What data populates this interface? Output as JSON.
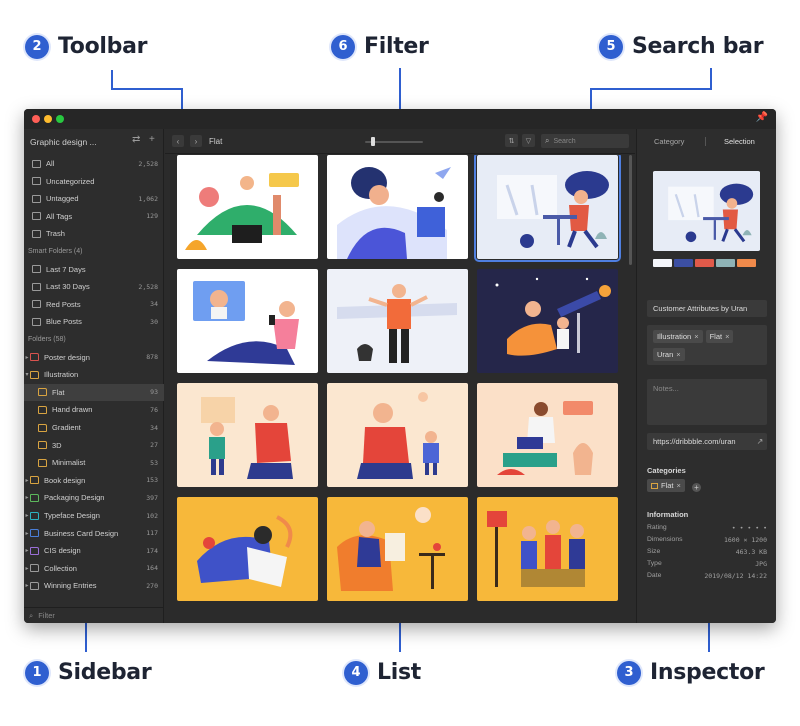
{
  "callouts": {
    "toolbar": {
      "num": "2",
      "label": "Toolbar"
    },
    "filter": {
      "num": "6",
      "label": "Filter"
    },
    "search": {
      "num": "5",
      "label": "Search bar"
    },
    "sidebar": {
      "num": "1",
      "label": "Sidebar"
    },
    "list": {
      "num": "4",
      "label": "List"
    },
    "inspector": {
      "num": "3",
      "label": "Inspector"
    }
  },
  "window": {
    "traffic_lights": [
      "#ff5f57",
      "#febc2e",
      "#28c840"
    ]
  },
  "sidebar": {
    "library_title": "Graphic design ...",
    "library_items": [
      {
        "label": "All",
        "count": "2,528"
      },
      {
        "label": "Uncategorized",
        "count": ""
      },
      {
        "label": "Untagged",
        "count": "1,062"
      },
      {
        "label": "All Tags",
        "count": "129"
      },
      {
        "label": "Trash",
        "count": ""
      }
    ],
    "smart_folders_header": "Smart Folders (4)",
    "smart_folders": [
      {
        "label": "Last 7 Days",
        "count": ""
      },
      {
        "label": "Last 30 Days",
        "count": "2,528"
      },
      {
        "label": "Red Posts",
        "count": "34"
      },
      {
        "label": "Blue Posts",
        "count": "30"
      }
    ],
    "folders_header": "Folders (58)",
    "folders": [
      {
        "label": "Poster design",
        "count": "878",
        "color": "#d9534f"
      },
      {
        "label": "Illustration",
        "count": "",
        "color": "#d9a441"
      },
      {
        "label": "Flat",
        "count": "93",
        "color": "#d9a441"
      },
      {
        "label": "Hand drawn",
        "count": "76",
        "color": "#d9a441"
      },
      {
        "label": "Gradient",
        "count": "34",
        "color": "#d9a441"
      },
      {
        "label": "3D",
        "count": "27",
        "color": "#d9a441"
      },
      {
        "label": "Minimalist",
        "count": "53",
        "color": "#d9a441"
      },
      {
        "label": "Book design",
        "count": "153",
        "color": "#d9a441"
      },
      {
        "label": "Packaging Design",
        "count": "397",
        "color": "#5cb85c"
      },
      {
        "label": "Typeface Design",
        "count": "102",
        "color": "#2bb3c0"
      },
      {
        "label": "Business Card Design",
        "count": "117",
        "color": "#4a7fd8"
      },
      {
        "label": "CIS design",
        "count": "174",
        "color": "#9b6fd8"
      },
      {
        "label": "Collection",
        "count": "164",
        "color": "#9a9a9a"
      },
      {
        "label": "Winning Entries",
        "count": "270",
        "color": "#9a9a9a"
      }
    ],
    "filter_placeholder": "Filter"
  },
  "toolbar": {
    "back": "‹",
    "forward": "›",
    "title": "Flat",
    "sort_icon": "⇅",
    "filter_icon": "▽",
    "search_placeholder": "Search"
  },
  "inspector": {
    "tab_category": "Category",
    "tab_selection": "Selection",
    "palette": [
      "#f4f6fb",
      "#3c4fa3",
      "#e05a4a",
      "#8fb3b6",
      "#f08a4b"
    ],
    "name": "Customer Attributes by Uran",
    "tags": [
      "Illustration",
      "Flat",
      "Uran"
    ],
    "notes_placeholder": "Notes...",
    "url": "https://dribbble.com/uran",
    "categories_heading": "Categories",
    "category_chip": "Flat",
    "information_heading": "Information",
    "info": {
      "rating_label": "Rating",
      "rating_value": "• • • • •",
      "dimensions_label": "Dimensions",
      "dimensions_value": "1600 × 1200",
      "size_label": "Size",
      "size_value": "463.3 KB",
      "type_label": "Type",
      "type_value": "JPG",
      "date_label": "Date",
      "date_value": "2019/08/12 14:22"
    }
  }
}
